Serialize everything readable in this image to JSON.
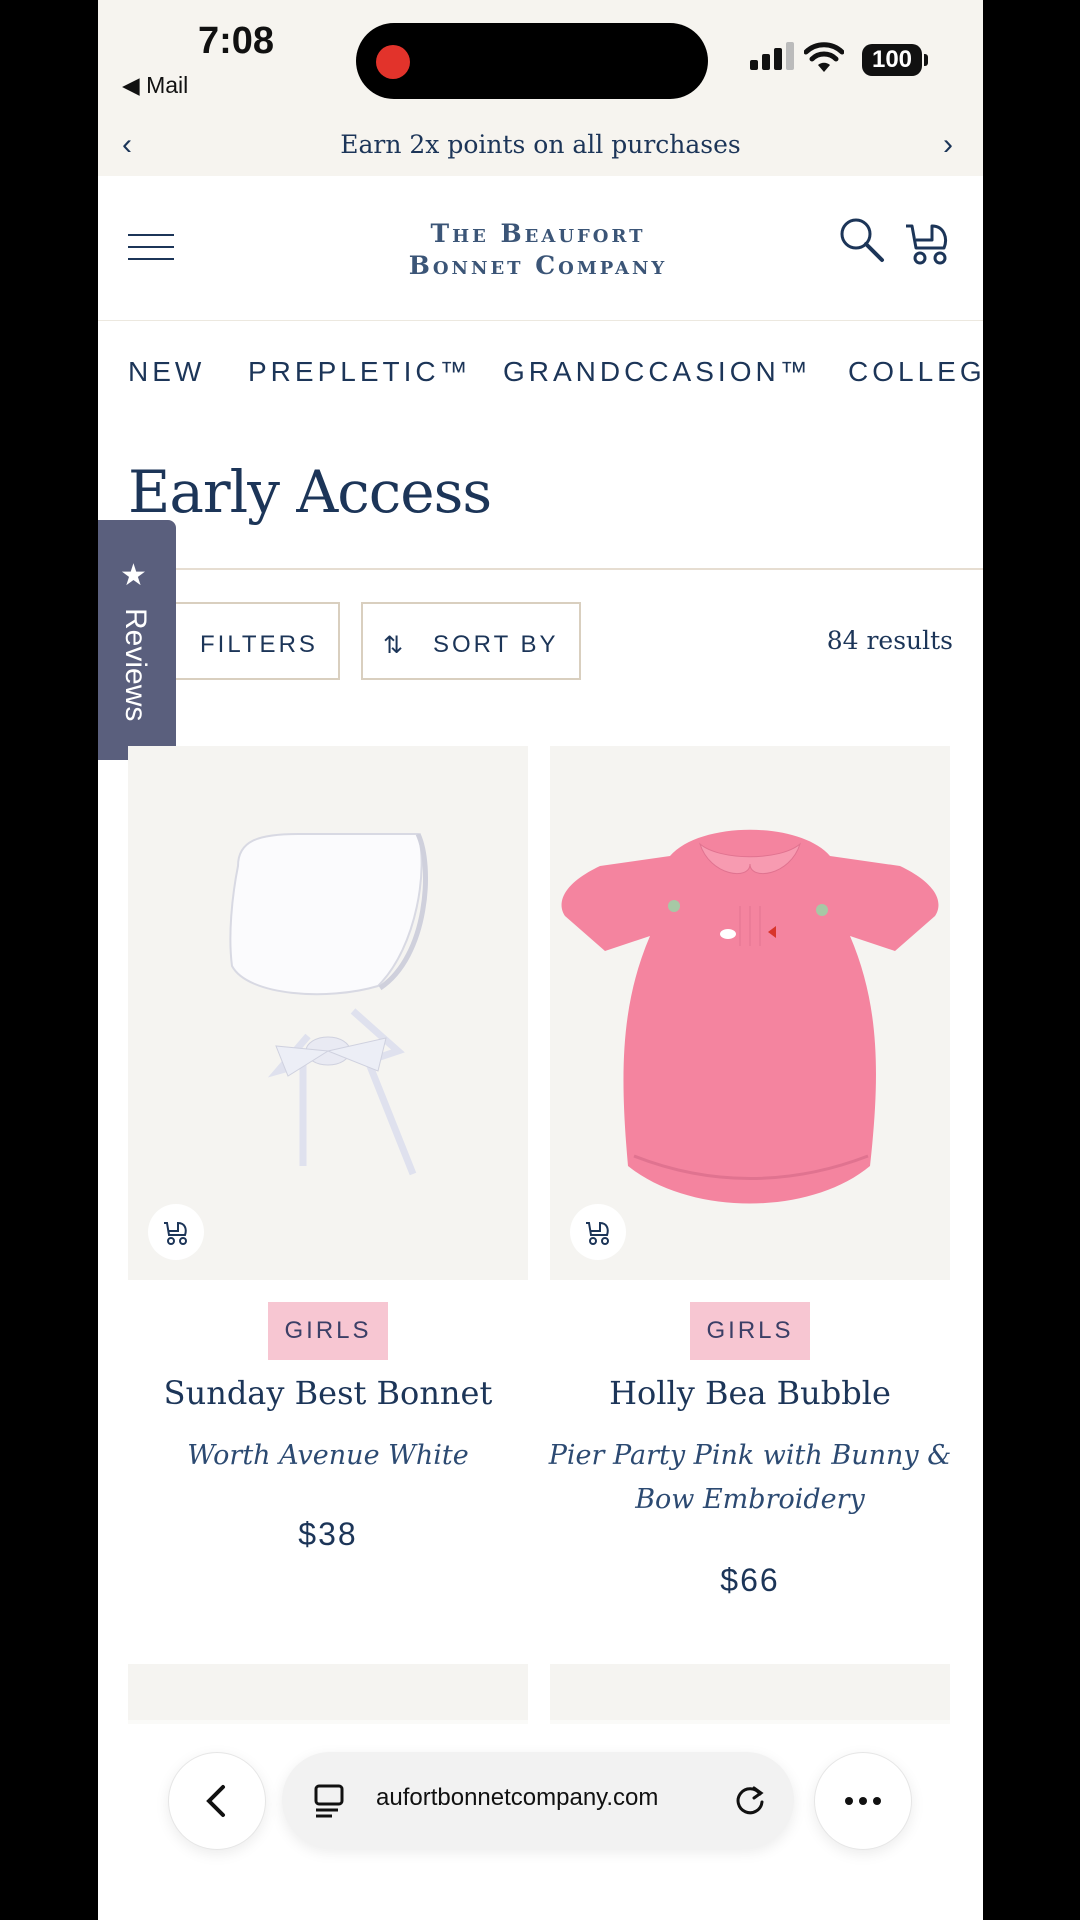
{
  "status_bar": {
    "time": "7:08",
    "back_app": "◀ Mail",
    "battery": "100"
  },
  "promo": {
    "text": "Earn 2x points on all purchases"
  },
  "header": {
    "logo_line1": "The Beaufort",
    "logo_line2": "Bonnet Company"
  },
  "nav": {
    "items": [
      "NEW",
      "PREPLETIC™",
      "GRANDCCASION™",
      "COLLEG"
    ]
  },
  "page": {
    "title": "Early Access"
  },
  "reviews_tab": {
    "label": "Reviews"
  },
  "toolbar": {
    "filters_label": "FILTERS",
    "sort_label": "SORT BY",
    "results": "84 results"
  },
  "products": [
    {
      "tag": "GIRLS",
      "name": "Sunday Best Bonnet",
      "variant": "Worth Avenue White",
      "price": "$38"
    },
    {
      "tag": "GIRLS",
      "name": "Holly Bea Bubble",
      "variant": "Pier Party Pink with Bunny & Bow Embroidery",
      "price": "$66"
    }
  ],
  "browser": {
    "url": "aufortbonnetcompany.com"
  },
  "colors": {
    "navy": "#1c3558",
    "tag_pink": "#f7c6d2",
    "reviews_tab": "#5a5f7d",
    "promo_bg": "#f6f4ef"
  }
}
